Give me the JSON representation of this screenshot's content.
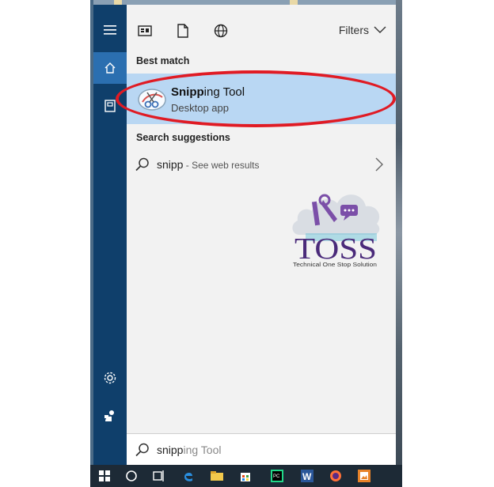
{
  "topbar": {
    "filters_label": "Filters",
    "icons": [
      "apps-icon",
      "documents-icon",
      "web-icon"
    ]
  },
  "sections": {
    "best_match": "Best match",
    "search_suggestions": "Search suggestions"
  },
  "best_match": {
    "title_bold": "Snipp",
    "title_rest": "ing Tool",
    "subtitle": "Desktop app"
  },
  "suggestion": {
    "query": "snipp",
    "suffix": " - See web results"
  },
  "search": {
    "typed": "snipp",
    "ghost": "ing Tool"
  },
  "logo": {
    "text": "TOSS",
    "tagline": "Technical One Stop Solution"
  },
  "sidebar": {
    "items": [
      "hamburger-icon",
      "home-icon",
      "notebook-icon",
      "settings-icon",
      "feedback-icon"
    ]
  },
  "taskbar": {
    "items": [
      "windows-start-icon",
      "cortana-icon",
      "task-view-icon",
      "edge-icon",
      "file-explorer-icon",
      "store-icon",
      "pycharm-icon",
      "word-icon",
      "firefox-icon",
      "photos-icon"
    ]
  },
  "colors": {
    "rail": "#0f3f6b",
    "rail_active": "#2b6fb0",
    "highlight": "#b9d7f3",
    "annotation": "#e01b24"
  }
}
